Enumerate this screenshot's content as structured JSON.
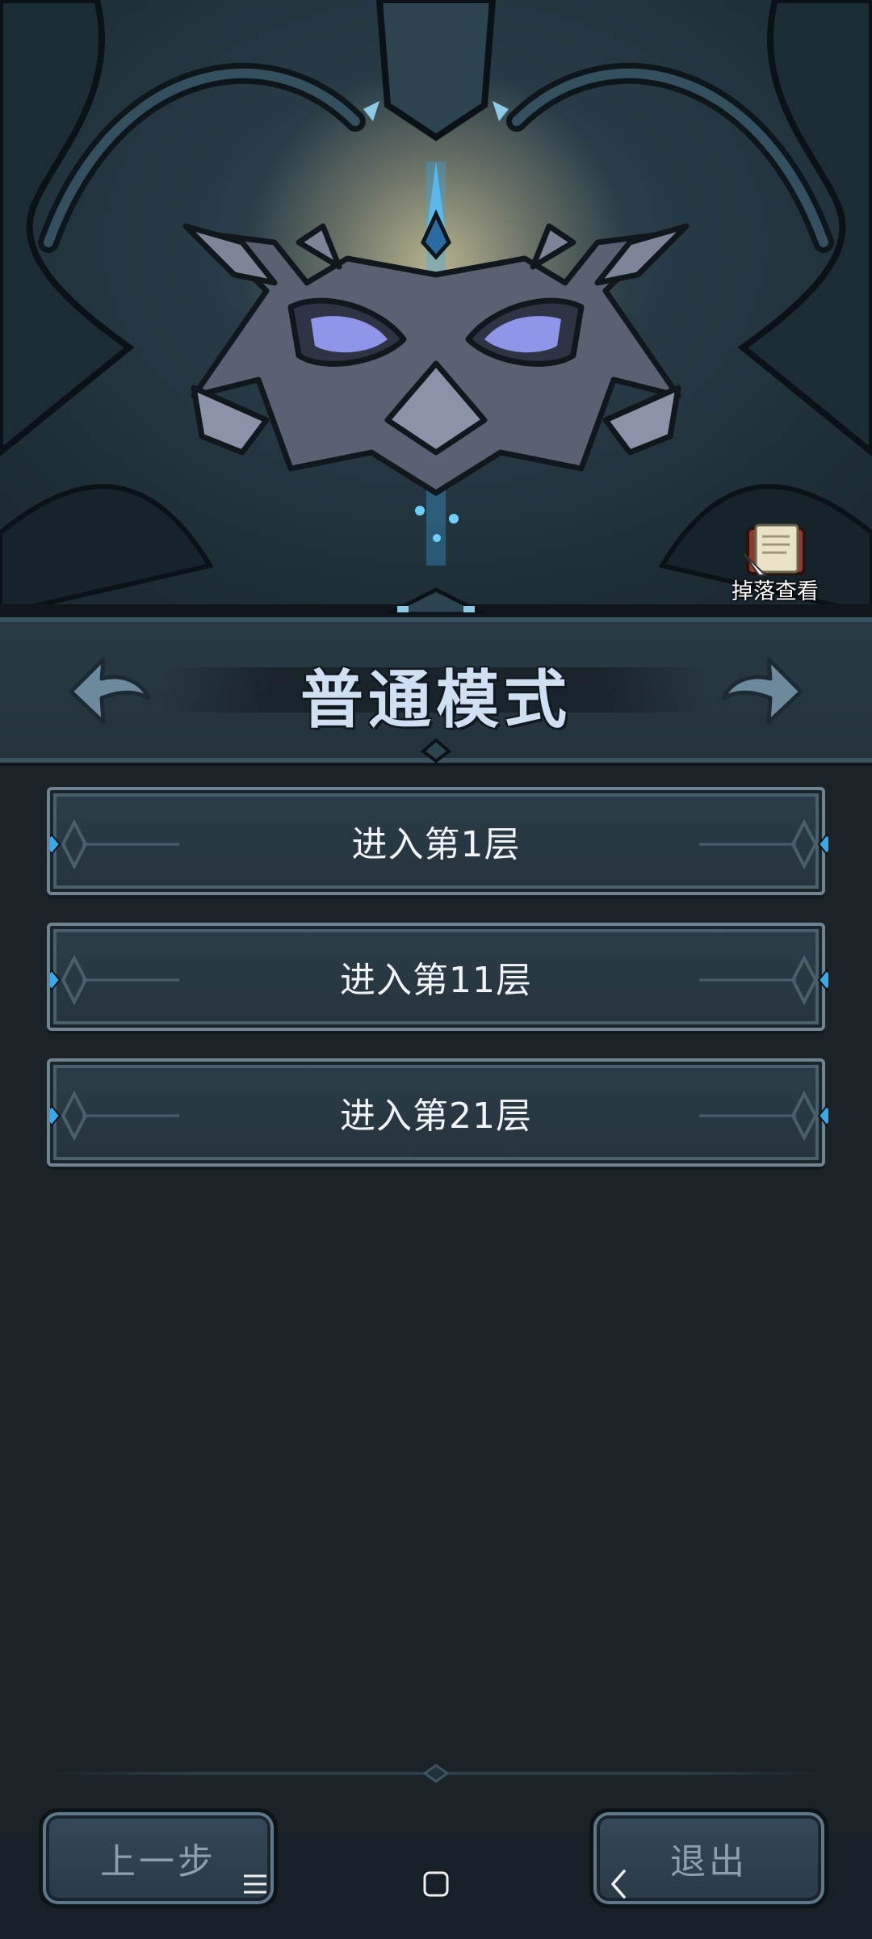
{
  "hero": {
    "drops_label": "掉落查看"
  },
  "mode": {
    "title": "普通模式"
  },
  "floors": [
    {
      "label": "进入第1层"
    },
    {
      "label": "进入第11层"
    },
    {
      "label": "进入第21层"
    }
  ],
  "footer": {
    "prev_label": "上一步",
    "exit_label": "退出"
  },
  "system_nav": {
    "menu_icon": "menu-icon",
    "home_icon": "home-icon",
    "back_icon": "back-icon"
  },
  "colors": {
    "background": "#1b2329",
    "title": "#cfe0f2",
    "gem_blue": "#3aa7e8"
  }
}
